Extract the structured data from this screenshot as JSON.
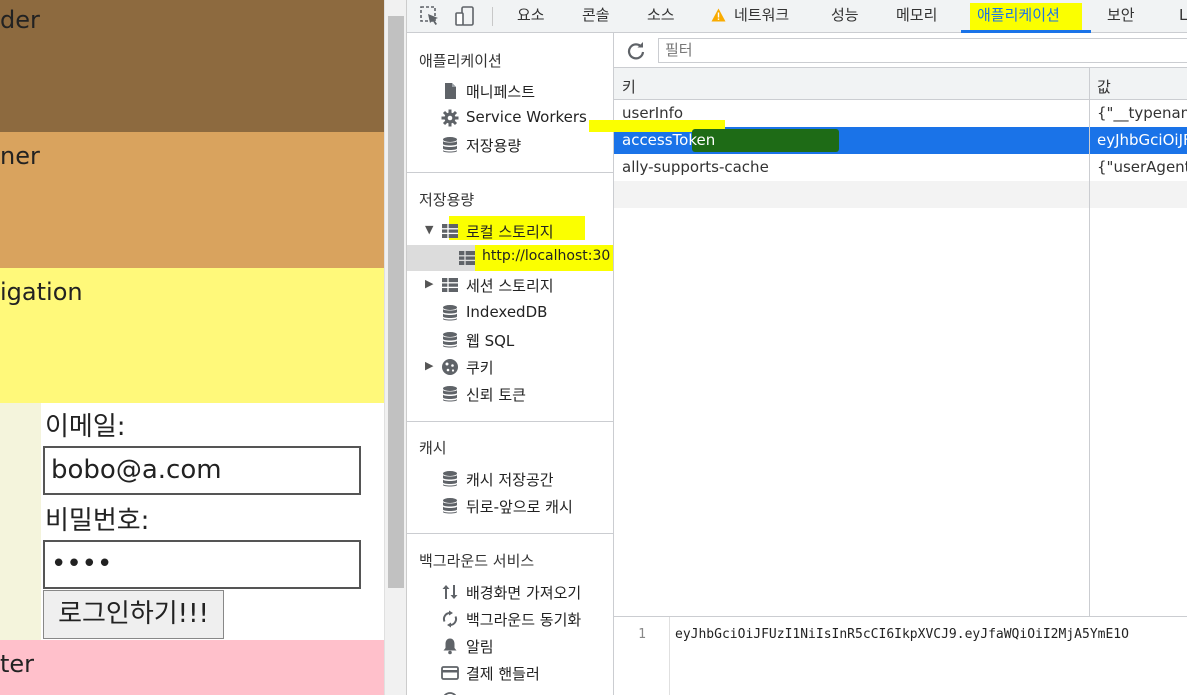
{
  "page": {
    "header_text": "der",
    "banner_text": "ner",
    "nav_text": "igation",
    "email_label": "이메일:",
    "email_value": "bobo@a.com",
    "password_label": "비밀번호:",
    "password_value": "••••",
    "login_button": "로그인하기!!!",
    "footer_text": "ter",
    "colors": {
      "header": "#8d6a3f",
      "banner": "#d9a35e",
      "nav": "#fff97a",
      "footer": "#ffc0cb"
    }
  },
  "devtools": {
    "tabs": [
      "요소",
      "콘솔",
      "소스",
      "네트워크",
      "성능",
      "메모리",
      "애플리케이션",
      "보안",
      "L"
    ],
    "active_tab": "애플리케이션",
    "sidebar": {
      "app_section": "애플리케이션",
      "app_items": [
        "매니페스트",
        "Service Workers",
        "저장용량"
      ],
      "storage_section": "저장용량",
      "storage_items": {
        "local_storage": "로컬 스토리지",
        "localhost": "http://localhost:30",
        "session_storage": "세션 스토리지",
        "indexeddb": "IndexedDB",
        "websql": "웹 SQL",
        "cookies": "쿠키",
        "trust_tokens": "신뢰 토큰"
      },
      "cache_section": "캐시",
      "cache_items": [
        "캐시 저장공간",
        "뒤로-앞으로 캐시"
      ],
      "background_section": "백그라운드 서비스",
      "background_items": [
        "배경화면 가져오기",
        "백그라운드 동기화",
        "알림",
        "결제 핸들러"
      ]
    },
    "filter_placeholder": "필터",
    "table": {
      "key_header": "키",
      "value_header": "값",
      "rows": [
        {
          "key": "userInfo",
          "value": "{\"__typename"
        },
        {
          "key": "accessToken",
          "value": "eyJhbGciOiJF"
        },
        {
          "key": "ally-supports-cache",
          "value": "{\"userAgent\""
        }
      ],
      "selected_row": 1
    },
    "preview": {
      "line_number": "1",
      "text": "eyJhbGciOiJFUzI1NiIsInR5cCI6IkpXVCJ9.eyJfaWQiOiI2MjA5YmE1O"
    },
    "accent_color": "#1a73e8"
  }
}
